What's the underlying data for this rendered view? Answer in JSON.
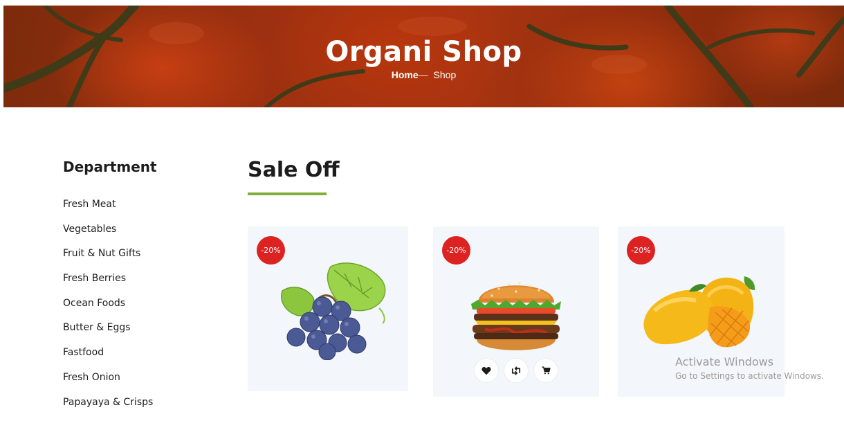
{
  "hero": {
    "title": "Organi Shop",
    "breadcrumb": {
      "home": "Home",
      "separator": "—",
      "current": "Shop"
    }
  },
  "sidebar": {
    "title": "Department",
    "items": [
      {
        "label": "Fresh Meat"
      },
      {
        "label": "Vegetables"
      },
      {
        "label": "Fruit & Nut Gifts"
      },
      {
        "label": "Fresh Berries"
      },
      {
        "label": "Ocean Foods"
      },
      {
        "label": "Butter & Eggs"
      },
      {
        "label": "Fastfood"
      },
      {
        "label": "Fresh Onion"
      },
      {
        "label": "Papayaya & Crisps"
      }
    ]
  },
  "sale": {
    "title": "Sale Off",
    "accent_color": "#7fad39",
    "products": [
      {
        "discount": "-20%",
        "image": "grapes"
      },
      {
        "discount": "-20%",
        "image": "burger"
      },
      {
        "discount": "-20%",
        "image": "mango"
      }
    ],
    "actions": [
      "heart-icon",
      "retweet-icon",
      "cart-icon"
    ]
  },
  "watermark": {
    "line1": "Activate Windows",
    "line2": "Go to Settings to activate Windows."
  },
  "colors": {
    "badge": "#dd2222",
    "card_bg": "#f3f6fa"
  }
}
